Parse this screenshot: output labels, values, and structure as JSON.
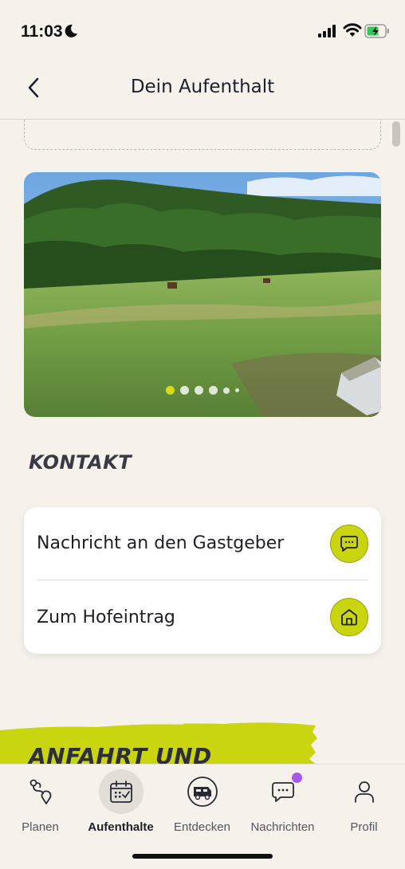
{
  "status_bar": {
    "time": "11:03",
    "icons": [
      "moon-icon",
      "signal-icon",
      "wifi-icon",
      "battery-charging-icon"
    ]
  },
  "header": {
    "title": "Dein Aufenthalt",
    "back_icon": "chevron-left-icon"
  },
  "carousel": {
    "dot_count": 6,
    "active_index": 0
  },
  "kontakt": {
    "title": "KONTAKT",
    "rows": [
      {
        "label": "Nachricht an den Gastgeber",
        "icon": "chat-icon"
      },
      {
        "label": "Zum Hofeintrag",
        "icon": "home-icon"
      }
    ]
  },
  "anfahrt": {
    "title": "ANFAHRT UND"
  },
  "tabs": [
    {
      "label": "Planen",
      "icon": "route-icon",
      "active": false
    },
    {
      "label": "Aufenthalte",
      "icon": "calendar-icon",
      "active": true
    },
    {
      "label": "Entdecken",
      "icon": "camper-icon",
      "active": false
    },
    {
      "label": "Nachrichten",
      "icon": "chat-icon",
      "active": false,
      "badge": true
    },
    {
      "label": "Profil",
      "icon": "person-icon",
      "active": false
    }
  ],
  "colors": {
    "background": "#f6f1eb",
    "accent": "#c9d50f",
    "badge": "#a259ec",
    "text": "#1f1f2c"
  }
}
